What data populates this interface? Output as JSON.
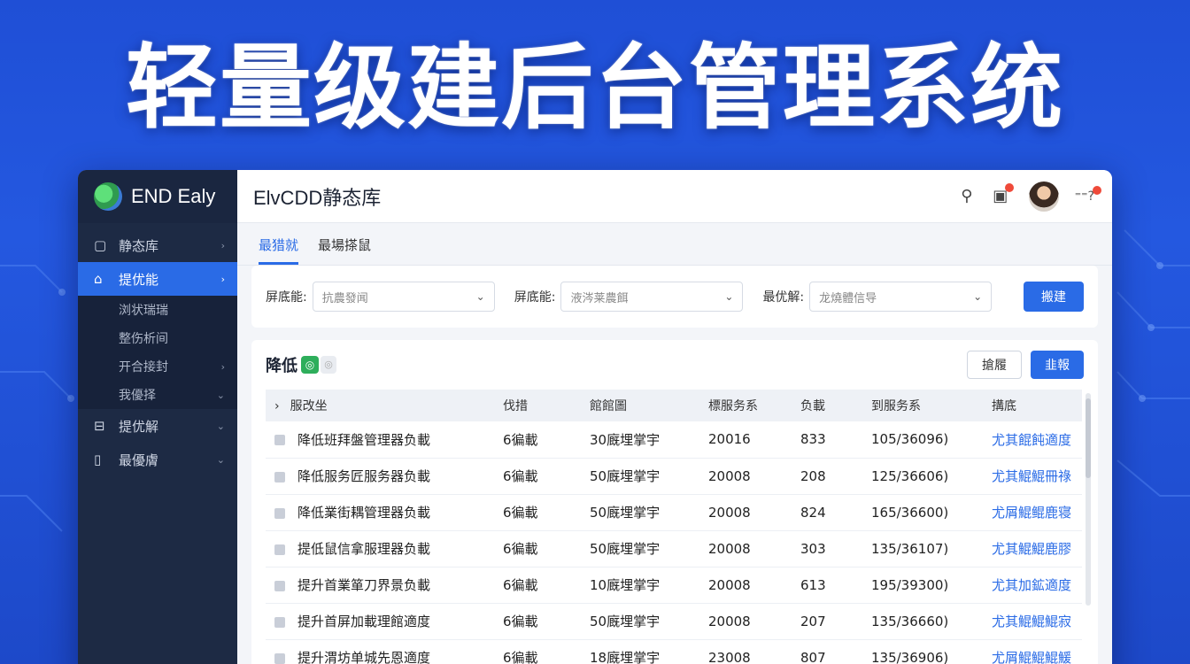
{
  "hero": {
    "title": "轻量级建后台管理系统"
  },
  "sidebar": {
    "brand": "END Ealy",
    "items": [
      {
        "label": "静态库",
        "icon": "file-icon",
        "arrow": "›"
      },
      {
        "label": "提优能",
        "icon": "folder-icon",
        "arrow": "›",
        "active": true
      },
      {
        "label": "浏状瑞瑞",
        "sub": true
      },
      {
        "label": "整伤析间",
        "sub": true
      },
      {
        "label": "开合接封",
        "sub": true,
        "arrow": "›"
      },
      {
        "label": "我優择",
        "sub": true,
        "arrow": "⌄"
      },
      {
        "label": "提优解",
        "icon": "server-icon",
        "arrow": "⌄"
      },
      {
        "label": "最優膚",
        "icon": "doc-icon",
        "arrow": "⌄"
      }
    ]
  },
  "topbar": {
    "title": "ElvCDD静态库",
    "more": "⁼⁼?"
  },
  "tabs": [
    {
      "label": "最猎就",
      "active": true
    },
    {
      "label": "最場搽鼠"
    }
  ],
  "filters": [
    {
      "label": "屏底能:",
      "value": "抗農發闻"
    },
    {
      "label": "屏底能:",
      "value": "液涔莱農餌"
    },
    {
      "label": "最优解:",
      "value": "龙燒體信导"
    }
  ],
  "filter_button": "搬建",
  "table": {
    "title": "降低",
    "tag": "◎",
    "tag2": "◎",
    "btn_outline": "搶履",
    "btn_blue": "韭報",
    "columns": [
      "服改坐",
      "伐措",
      "館館圖",
      "標服务系",
      "负載",
      "到服务系",
      "搆底"
    ],
    "rows": [
      [
        "降低班拜盤管理器负載",
        "6徧載",
        "30廐埋掌宇",
        "20016",
        "833",
        "105/36096)",
        "尤其餛飩適度"
      ],
      [
        "降低服务匠服务器负載",
        "6徧載",
        "50廐埋掌宇",
        "20008",
        "208",
        "125/36606)",
        "尤其鯤鯤冊祿"
      ],
      [
        "降低業街耦管理器负載",
        "6徧載",
        "50廐埋掌宇",
        "20008",
        "824",
        "165/36600)",
        "尤屑鯤鲲鹿寝"
      ],
      [
        "提低鼠信拿服理器负載",
        "6徧載",
        "50廐埋掌宇",
        "20008",
        "303",
        "135/36107)",
        "尤其鯤鯤鹿膠"
      ],
      [
        "提升首業箪刀界景负載",
        "6徧載",
        "10廐埋掌宇",
        "20008",
        "613",
        "195/39300)",
        "尤其加鉱適度"
      ],
      [
        "提升首屏加載理館適度",
        "6徧載",
        "50廐埋掌宇",
        "20008",
        "207",
        "135/36660)",
        "尤其鯤鯤鯤寂"
      ],
      [
        "提升渭坊单城先恩適度",
        "6徧載",
        "18廐埋掌宇",
        "23008",
        "807",
        "135/36906)",
        "尤屑鯤鯤鯤鰀"
      ]
    ]
  },
  "colors": {
    "accent": "#2a6be6",
    "sidebar_bg": "#1d2a44",
    "hero_bg": "#2458e0"
  }
}
